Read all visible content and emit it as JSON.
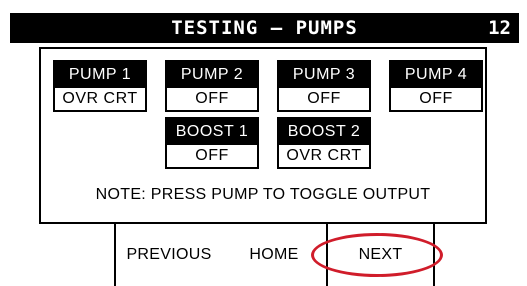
{
  "title_bar": {
    "title": "TESTING – PUMPS",
    "page_number": "12"
  },
  "pumps": [
    {
      "label": "PUMP 1",
      "status": "OVR CRT"
    },
    {
      "label": "PUMP 2",
      "status": "OFF"
    },
    {
      "label": "PUMP 3",
      "status": "OFF"
    },
    {
      "label": "PUMP 4",
      "status": "OFF"
    }
  ],
  "boosts": [
    {
      "label": "BOOST 1",
      "status": "OFF"
    },
    {
      "label": "BOOST 2",
      "status": "OVR CRT"
    }
  ],
  "note": "NOTE: PRESS PUMP TO TOGGLE OUTPUT",
  "nav": {
    "previous_label": "PREVIOUS",
    "home_label": "HOME",
    "next_label": "NEXT"
  },
  "colors": {
    "highlight": "#d01c2a",
    "foreground": "#000000",
    "background": "#ffffff"
  }
}
